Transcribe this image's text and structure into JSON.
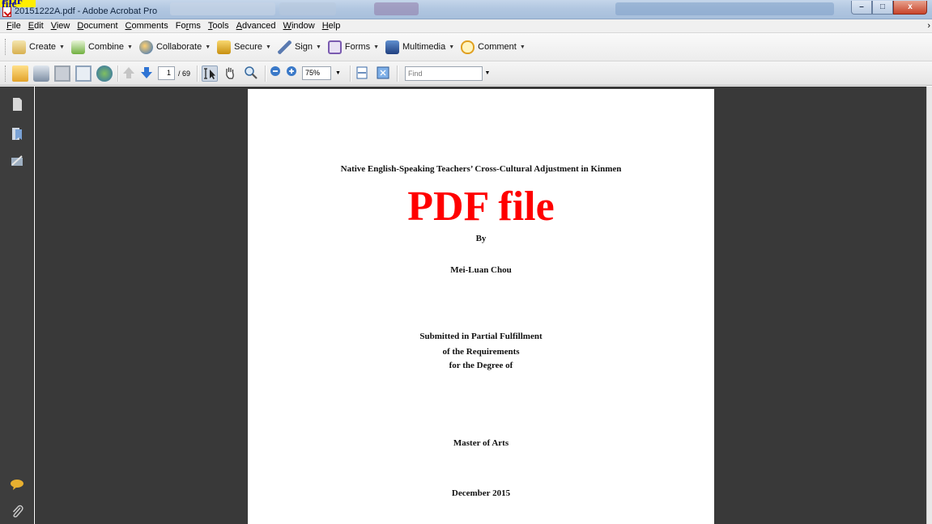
{
  "overlay_label": "PDF file",
  "window": {
    "title": "20151222A.pdf - Adobe Acrobat Pro",
    "minimize": "–",
    "maximize": "□",
    "close": "x"
  },
  "menu": [
    {
      "label": "File",
      "acc": "F",
      "rest": "ile"
    },
    {
      "label": "Edit",
      "acc": "E",
      "rest": "dit"
    },
    {
      "label": "View",
      "acc": "V",
      "rest": "iew"
    },
    {
      "label": "Document",
      "acc": "D",
      "rest": "ocument"
    },
    {
      "label": "Comments",
      "acc": "C",
      "rest": "omments"
    },
    {
      "label": "Forms",
      "pre": "Fo",
      "acc": "r",
      "rest": "ms"
    },
    {
      "label": "Tools",
      "acc": "T",
      "rest": "ools"
    },
    {
      "label": "Advanced",
      "acc": "A",
      "rest": "dvanced"
    },
    {
      "label": "Window",
      "acc": "W",
      "rest": "indow"
    },
    {
      "label": "Help",
      "acc": "H",
      "rest": "elp"
    }
  ],
  "tasks": {
    "create": "Create",
    "combine": "Combine",
    "collaborate": "Collaborate",
    "secure": "Secure",
    "sign": "Sign",
    "forms": "Forms",
    "multimedia": "Multimedia",
    "comment": "Comment"
  },
  "nav": {
    "page_number": "1",
    "page_total": "/ 69",
    "zoom": "75%",
    "find_placeholder": "Find"
  },
  "icons": {
    "open": "open-folder-icon",
    "print": "print-icon",
    "save": "save-icon",
    "email": "email-icon",
    "web": "web-collaboration-icon",
    "prev": "previous-page-icon",
    "next": "next-page-icon",
    "select": "select-text-icon",
    "hand": "hand-tool-icon",
    "marquee": "marquee-zoom-icon",
    "zoom_out": "zoom-out-icon",
    "zoom_in": "zoom-in-icon",
    "fit_width": "fit-width-icon",
    "fit_page": "fit-page-icon",
    "pages": "pages-panel-icon",
    "bookmarks": "bookmarks-panel-icon",
    "signatures": "signatures-panel-icon",
    "comments_panel": "comments-panel-icon",
    "attachments": "attachments-panel-icon"
  },
  "document": {
    "title": "Native English-Speaking Teachers’ Cross-Cultural Adjustment in Kinmen",
    "stamp": "PDF file",
    "by": "By",
    "author": "Mei-Luan Chou",
    "submitted_1": "Submitted in Partial Fulfillment",
    "submitted_2": "of the Requirements",
    "submitted_3": "for the Degree of",
    "degree": "Master of Arts",
    "date": "December 2015"
  },
  "colors": {
    "stamp_red": "#ff0000",
    "overlay_yellow": "#ffee00",
    "doc_background": "#393939"
  }
}
